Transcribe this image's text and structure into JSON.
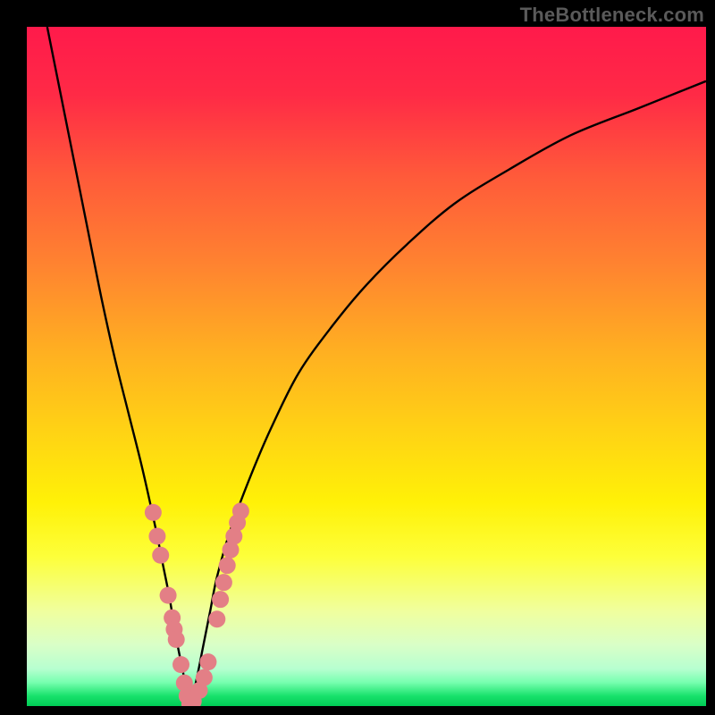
{
  "watermark": "TheBottleneck.com",
  "colors": {
    "gradient_stops": [
      {
        "offset": 0.0,
        "color": "#ff1a4b"
      },
      {
        "offset": 0.1,
        "color": "#ff2a46"
      },
      {
        "offset": 0.22,
        "color": "#ff5a3a"
      },
      {
        "offset": 0.35,
        "color": "#ff8330"
      },
      {
        "offset": 0.48,
        "color": "#ffb021"
      },
      {
        "offset": 0.6,
        "color": "#ffd414"
      },
      {
        "offset": 0.7,
        "color": "#fff107"
      },
      {
        "offset": 0.78,
        "color": "#fdff3a"
      },
      {
        "offset": 0.86,
        "color": "#f0ff9e"
      },
      {
        "offset": 0.91,
        "color": "#d9ffc7"
      },
      {
        "offset": 0.945,
        "color": "#b7ffd0"
      },
      {
        "offset": 0.965,
        "color": "#78ffb0"
      },
      {
        "offset": 0.985,
        "color": "#18e26c"
      },
      {
        "offset": 1.0,
        "color": "#00cc55"
      }
    ],
    "curve": "#000000",
    "marker_fill": "#e37f86",
    "marker_stroke": "#7e2b34",
    "black": "#000000"
  },
  "chart_data": {
    "type": "line",
    "title": "",
    "xlabel": "",
    "ylabel": "",
    "xlim": [
      0,
      100
    ],
    "ylim": [
      0,
      100
    ],
    "x_min_at": 24,
    "series": [
      {
        "name": "bottleneck-curve",
        "x": [
          3,
          5,
          7,
          9,
          11,
          13,
          15,
          17,
          19,
          20,
          21,
          22,
          23,
          24,
          25,
          26,
          27,
          28,
          30,
          33,
          36,
          40,
          45,
          50,
          56,
          63,
          71,
          80,
          90,
          100
        ],
        "y": [
          100,
          90,
          80,
          70,
          60,
          51,
          43,
          35,
          26,
          21,
          16,
          10,
          5,
          0,
          4,
          9,
          14,
          19,
          26,
          34,
          41,
          49,
          56,
          62,
          68,
          74,
          79,
          84,
          88,
          92
        ]
      }
    ],
    "markers_left": [
      {
        "x": 18.6,
        "y": 28.5
      },
      {
        "x": 19.2,
        "y": 25.0
      },
      {
        "x": 19.7,
        "y": 22.2
      },
      {
        "x": 20.8,
        "y": 16.3
      },
      {
        "x": 21.4,
        "y": 13.0
      },
      {
        "x": 21.7,
        "y": 11.3
      },
      {
        "x": 22.0,
        "y": 9.8
      },
      {
        "x": 22.7,
        "y": 6.1
      },
      {
        "x": 23.2,
        "y": 3.4
      },
      {
        "x": 23.6,
        "y": 1.5
      },
      {
        "x": 24.0,
        "y": 0.3
      },
      {
        "x": 24.5,
        "y": 0.7
      }
    ],
    "markers_right": [
      {
        "x": 25.4,
        "y": 2.3
      },
      {
        "x": 26.1,
        "y": 4.2
      },
      {
        "x": 26.7,
        "y": 6.5
      },
      {
        "x": 28.0,
        "y": 12.8
      },
      {
        "x": 28.5,
        "y": 15.7
      },
      {
        "x": 29.0,
        "y": 18.2
      },
      {
        "x": 29.5,
        "y": 20.7
      },
      {
        "x": 30.0,
        "y": 23.0
      },
      {
        "x": 30.5,
        "y": 25.0
      },
      {
        "x": 31.0,
        "y": 27.0
      },
      {
        "x": 31.5,
        "y": 28.7
      }
    ]
  }
}
